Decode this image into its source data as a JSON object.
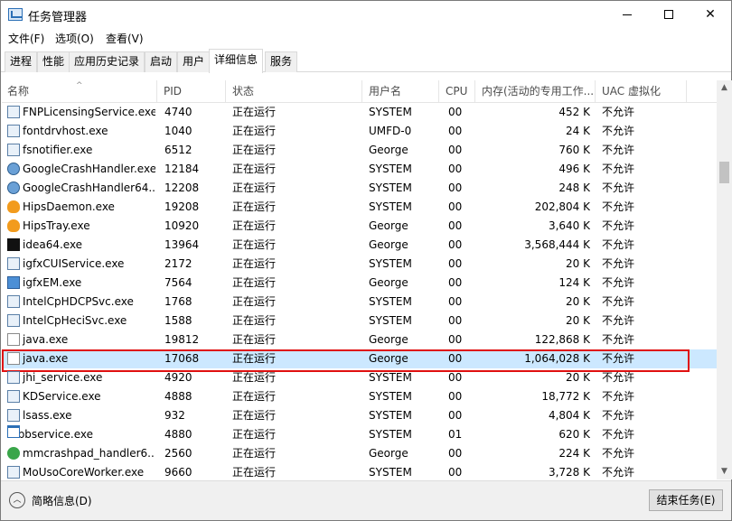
{
  "window": {
    "title": "任务管理器",
    "icon": "task-manager-icon",
    "minimize_symbol": "—",
    "maximize_symbol": "☐",
    "close_symbol": "✕"
  },
  "menu": [
    "文件(F)",
    "选项(O)",
    "查看(V)"
  ],
  "tabs": [
    "进程",
    "性能",
    "应用历史记录",
    "启动",
    "用户",
    "详细信息",
    "服务"
  ],
  "active_tab": "详细信息",
  "columns": [
    "名称",
    "PID",
    "状态",
    "用户名",
    "CPU",
    "内存(活动的专用工作...",
    "UAC 虚拟化"
  ],
  "sort_indicator": "^",
  "rows": [
    {
      "name": "FNPLicensingService.exe",
      "pid": "4740",
      "status": "正在运行",
      "user": "SYSTEM",
      "cpu": "00",
      "memory": "452 K",
      "uac": "不允许",
      "icon": "service-icon"
    },
    {
      "name": "fontdrvhost.exe",
      "pid": "1040",
      "status": "正在运行",
      "user": "UMFD-0",
      "cpu": "00",
      "memory": "24 K",
      "uac": "不允许",
      "icon": "service-icon"
    },
    {
      "name": "fsnotifier.exe",
      "pid": "6512",
      "status": "正在运行",
      "user": "George",
      "cpu": "00",
      "memory": "760 K",
      "uac": "不允许",
      "icon": "service-icon"
    },
    {
      "name": "GoogleCrashHandler.exe",
      "pid": "12184",
      "status": "正在运行",
      "user": "SYSTEM",
      "cpu": "00",
      "memory": "496 K",
      "uac": "不允许",
      "icon": "gear-icon"
    },
    {
      "name": "GoogleCrashHandler64...",
      "pid": "12208",
      "status": "正在运行",
      "user": "SYSTEM",
      "cpu": "00",
      "memory": "248 K",
      "uac": "不允许",
      "icon": "gear-icon"
    },
    {
      "name": "HipsDaemon.exe",
      "pid": "19208",
      "status": "正在运行",
      "user": "SYSTEM",
      "cpu": "00",
      "memory": "202,804 K",
      "uac": "不允许",
      "icon": "flame-icon"
    },
    {
      "name": "HipsTray.exe",
      "pid": "10920",
      "status": "正在运行",
      "user": "George",
      "cpu": "00",
      "memory": "3,640 K",
      "uac": "不允许",
      "icon": "flame-icon"
    },
    {
      "name": "idea64.exe",
      "pid": "13964",
      "status": "正在运行",
      "user": "George",
      "cpu": "00",
      "memory": "3,568,444 K",
      "uac": "不允许",
      "icon": "idea-icon"
    },
    {
      "name": "igfxCUIService.exe",
      "pid": "2172",
      "status": "正在运行",
      "user": "SYSTEM",
      "cpu": "00",
      "memory": "20 K",
      "uac": "不允许",
      "icon": "service-icon"
    },
    {
      "name": "igfxEM.exe",
      "pid": "7564",
      "status": "正在运行",
      "user": "George",
      "cpu": "00",
      "memory": "124 K",
      "uac": "不允许",
      "icon": "blue-app-icon"
    },
    {
      "name": "IntelCpHDCPSvc.exe",
      "pid": "1768",
      "status": "正在运行",
      "user": "SYSTEM",
      "cpu": "00",
      "memory": "20 K",
      "uac": "不允许",
      "icon": "service-icon"
    },
    {
      "name": "IntelCpHeciSvc.exe",
      "pid": "1588",
      "status": "正在运行",
      "user": "SYSTEM",
      "cpu": "00",
      "memory": "20 K",
      "uac": "不允许",
      "icon": "service-icon"
    },
    {
      "name": "java.exe",
      "pid": "19812",
      "status": "正在运行",
      "user": "George",
      "cpu": "00",
      "memory": "122,868 K",
      "uac": "不允许",
      "icon": "java-icon"
    },
    {
      "name": "java.exe",
      "pid": "17068",
      "status": "正在运行",
      "user": "George",
      "cpu": "00",
      "memory": "1,064,028 K",
      "uac": "不允许",
      "icon": "java-icon",
      "selected": true
    },
    {
      "name": "jhi_service.exe",
      "pid": "4920",
      "status": "正在运行",
      "user": "SYSTEM",
      "cpu": "00",
      "memory": "20 K",
      "uac": "不允许",
      "icon": "service-icon"
    },
    {
      "name": "KDService.exe",
      "pid": "4888",
      "status": "正在运行",
      "user": "SYSTEM",
      "cpu": "00",
      "memory": "18,772 K",
      "uac": "不允许",
      "icon": "service-icon"
    },
    {
      "name": "lsass.exe",
      "pid": "932",
      "status": "正在运行",
      "user": "SYSTEM",
      "cpu": "00",
      "memory": "4,804 K",
      "uac": "不允许",
      "icon": "service-icon"
    },
    {
      "name": "mbbservice.exe",
      "pid": "4880",
      "status": "正在运行",
      "user": "SYSTEM",
      "cpu": "01",
      "memory": "620 K",
      "uac": "不允许",
      "icon": "window-icon"
    },
    {
      "name": "mmcrashpad_handler6...",
      "pid": "2560",
      "status": "正在运行",
      "user": "George",
      "cpu": "00",
      "memory": "224 K",
      "uac": "不允许",
      "icon": "wechat-icon"
    },
    {
      "name": "MoUsoCoreWorker.exe",
      "pid": "9660",
      "status": "正在运行",
      "user": "SYSTEM",
      "cpu": "00",
      "memory": "3,728 K",
      "uac": "不允许",
      "icon": "service-icon"
    }
  ],
  "footer": {
    "fewer_details": "简略信息(D)",
    "end_task": "结束任务(E)"
  }
}
